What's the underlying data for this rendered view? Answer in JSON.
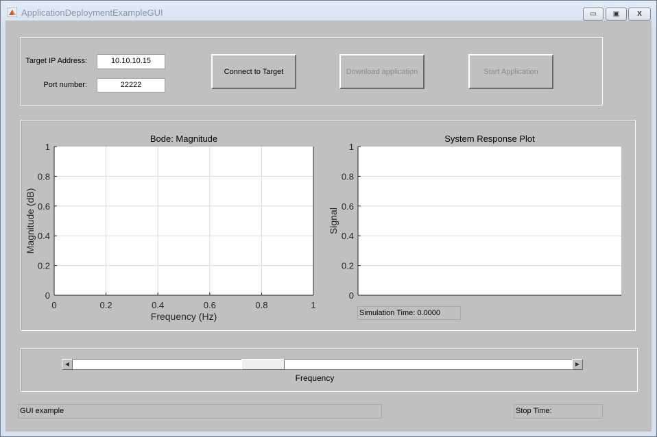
{
  "window": {
    "title": "ApplicationDeploymentExampleGUI",
    "controls": {
      "minimize": "▭",
      "restore": "▣",
      "close": "X"
    }
  },
  "connection": {
    "ip_label": "Target IP Address:",
    "ip_value": "10.10.10.15",
    "port_label": "Port number:",
    "port_value": "22222",
    "connect_button": "Connect to Target",
    "download_button": "Download application",
    "start_button": "Start Application"
  },
  "chart_data": [
    {
      "type": "line",
      "title": "Bode: Magnitude",
      "xlabel": "Frequency (Hz)",
      "ylabel": "Magnitude (dB)",
      "xlim": [
        0,
        1
      ],
      "ylim": [
        0,
        1
      ],
      "grid": "both",
      "xticks": [
        "0",
        "0.2",
        "0.4",
        "0.6",
        "0.8",
        "1"
      ],
      "yticks": [
        "0",
        "0.2",
        "0.4",
        "0.6",
        "0.8",
        "1"
      ],
      "series": []
    },
    {
      "type": "line",
      "title": "System Response Plot",
      "xlabel": "",
      "ylabel": "Signal",
      "ylim": [
        0,
        1
      ],
      "grid": "y",
      "xticks": [],
      "yticks": [
        "0",
        "0.2",
        "0.4",
        "0.6",
        "0.8",
        "1"
      ],
      "series": []
    }
  ],
  "simulation_time": "Simulation Time: 0.0000",
  "slider": {
    "label": "Frequency",
    "value_fraction": 0.37,
    "left_arrow": "◀",
    "right_arrow": "▶"
  },
  "status": {
    "message": "GUI example",
    "stop_time": "Stop Time:"
  }
}
